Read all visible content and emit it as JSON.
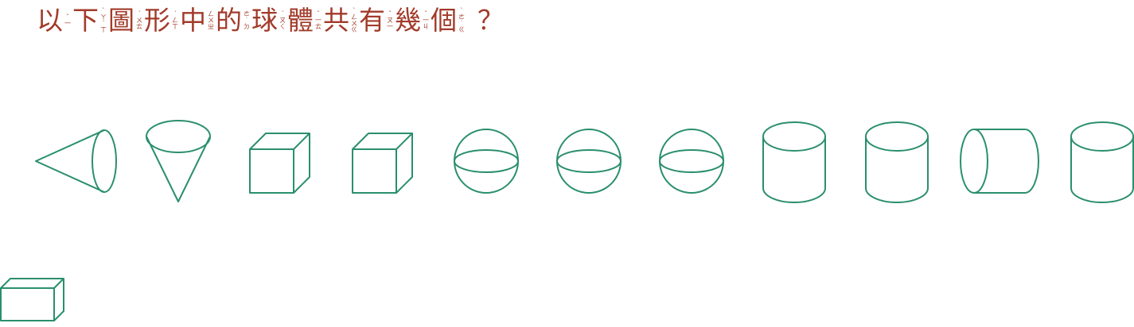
{
  "question": {
    "segments": [
      {
        "char": "以",
        "zhuyin": "ˇ一"
      },
      {
        "char": "下",
        "zhuyin": "ˋㄚˊㄒ"
      },
      {
        "char": "圖",
        "zhuyin": "ˊㄨㄊ"
      },
      {
        "char": "形",
        "zhuyin": "ˊㄥㄒ"
      },
      {
        "char": "中",
        "zhuyin": "ㄥㄨㄓ"
      },
      {
        "char": "的",
        "zhuyin": "ㄜ˙ㄉ"
      },
      {
        "char": "球",
        "zhuyin": "ˊㄡㄑ"
      },
      {
        "char": "體",
        "zhuyin": "ˇ一ㄊ"
      },
      {
        "char": "共",
        "zhuyin": "ˋㄥㄨㄍ"
      },
      {
        "char": "有",
        "zhuyin": "ˇㄡ一"
      },
      {
        "char": "幾",
        "zhuyin": "ˇ一ㄐ"
      },
      {
        "char": "個",
        "zhuyin": "ˋㄜ˙ㄍ"
      }
    ],
    "punctuation": "？"
  },
  "shapes": {
    "stroke_color": "#2a8f6c",
    "items": [
      {
        "kind": "cone-horizontal"
      },
      {
        "kind": "cone-inverted"
      },
      {
        "kind": "cube"
      },
      {
        "kind": "cube"
      },
      {
        "kind": "sphere"
      },
      {
        "kind": "sphere"
      },
      {
        "kind": "sphere"
      },
      {
        "kind": "cylinder-upright"
      },
      {
        "kind": "cylinder-upright"
      },
      {
        "kind": "cylinder-horizontal"
      },
      {
        "kind": "cylinder-upright"
      },
      {
        "kind": "cuboid"
      }
    ]
  }
}
